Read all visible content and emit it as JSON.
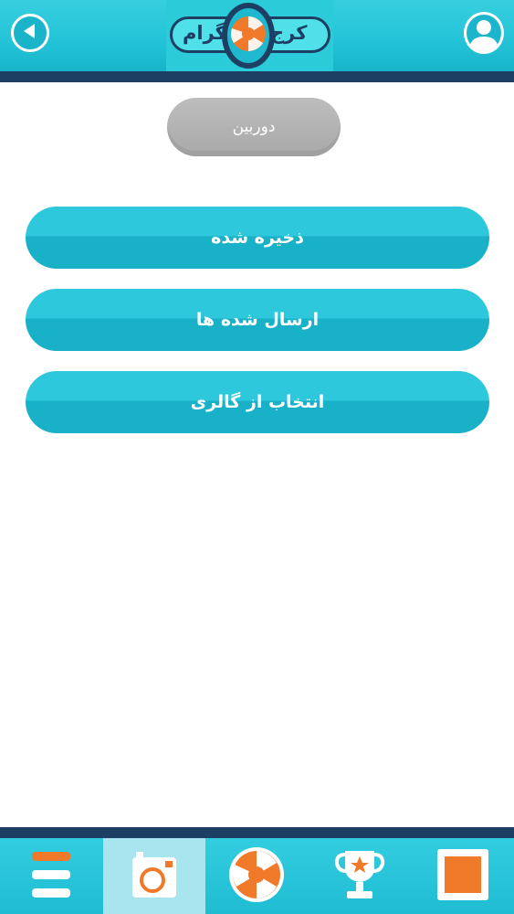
{
  "header": {
    "logo_word_right": "کرج",
    "logo_word_left": "گرام",
    "icons": {
      "back": "back-arrow-icon",
      "profile": "user-profile-icon",
      "logo": "aperture-icon"
    }
  },
  "main": {
    "camera_label": "دوربین",
    "options": [
      {
        "label": "ذخیره شده"
      },
      {
        "label": "ارسال شده ها"
      },
      {
        "label": "انتخاب از گالری"
      }
    ]
  },
  "bottom_nav": {
    "items": [
      {
        "icon": "menu-icon",
        "active": false
      },
      {
        "icon": "camera-icon",
        "active": true
      },
      {
        "icon": "aperture-icon",
        "active": false
      },
      {
        "icon": "trophy-icon",
        "active": false
      },
      {
        "icon": "stamp-icon",
        "active": false
      }
    ]
  },
  "colors": {
    "primary": "#22c2d6",
    "dark": "#1d3f63",
    "accent": "#f07a2a",
    "gray_pill": "#b0b0b0",
    "active_tab": "#a9e5ef"
  }
}
